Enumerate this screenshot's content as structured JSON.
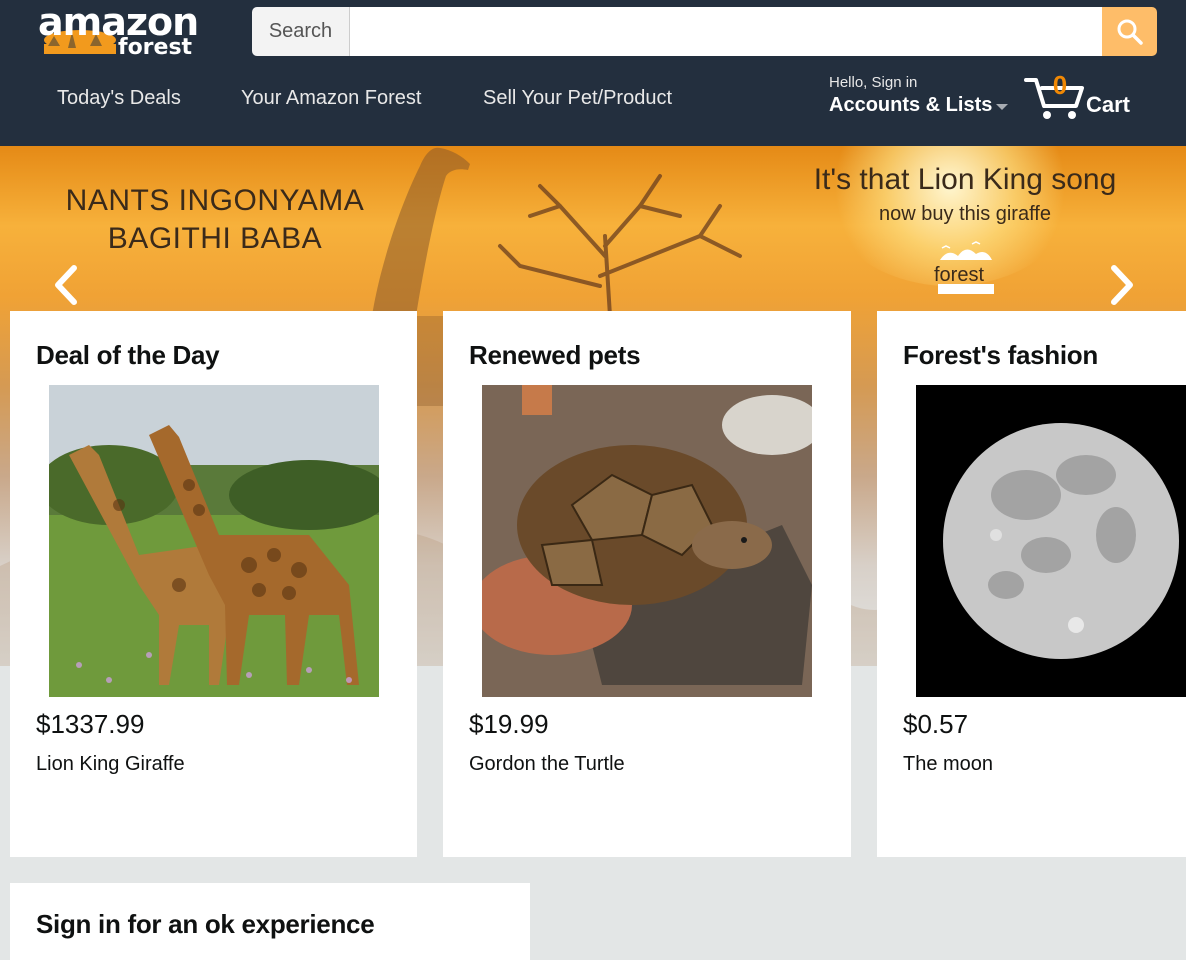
{
  "header": {
    "logo_word": "amazon",
    "logo_sub": "forest",
    "search": {
      "category_label": "Search",
      "value": "",
      "placeholder": ""
    },
    "nav_links": [
      "Today's Deals",
      "Your Amazon Forest",
      "Sell Your Pet/Product"
    ],
    "account": {
      "greeting": "Hello, Sign in",
      "label": "Accounts & Lists"
    },
    "cart": {
      "count": "0",
      "label": "Cart"
    }
  },
  "hero": {
    "left_line1": "NANTS INGONYAMA",
    "left_line2": "BAGITHI BABA",
    "right_line1": "It's that Lion King song",
    "right_line2": "now buy this giraffe",
    "logo_text": "forest"
  },
  "cards": [
    {
      "title": "Deal of the Day",
      "price": "$1337.99",
      "name": "Lion King Giraffe"
    },
    {
      "title": "Renewed pets",
      "price": "$19.99",
      "name": "Gordon the Turtle"
    },
    {
      "title": "Forest's fashion",
      "price": "$0.57",
      "name": "The moon"
    }
  ],
  "signin": {
    "title": "Sign in for an ok experience"
  },
  "colors": {
    "header_bg": "#232f3e",
    "search_button": "#febd69",
    "cart_count": "#f08804",
    "page_bg": "#e3e6e6"
  },
  "icons": [
    "search-icon",
    "cart-icon",
    "chevron-left-icon",
    "chevron-right-icon",
    "caret-down-icon"
  ]
}
